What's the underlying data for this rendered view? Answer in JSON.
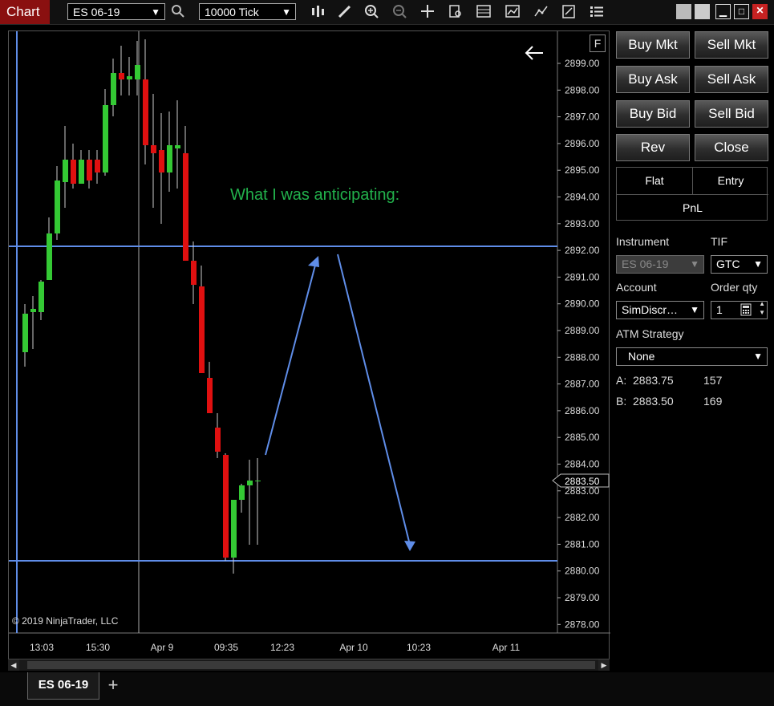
{
  "toolbar": {
    "app_title": "Chart",
    "instrument": "ES 06-19",
    "interval": "10000 Tick"
  },
  "chart": {
    "float_button": "F",
    "annotation": "What I was anticipating:",
    "copyright": "© 2019 NinjaTrader, LLC",
    "current_price": "2883.50",
    "price_axis": [
      "2899.00",
      "2898.00",
      "2897.00",
      "2896.00",
      "2895.00",
      "2894.00",
      "2893.00",
      "2892.00",
      "2891.00",
      "2890.00",
      "2889.00",
      "2888.00",
      "2887.00",
      "2886.00",
      "2885.00",
      "2884.00",
      "2883.00",
      "2882.00",
      "2881.00",
      "2880.00",
      "2879.00",
      "2878.00"
    ],
    "time_axis": [
      "13:03",
      "15:30",
      "Apr 9",
      "09:35",
      "12:23",
      "Apr 10",
      "10:23",
      "Apr 11"
    ],
    "colors": {
      "up": "#34c934",
      "down": "#e01010",
      "line": "#5f8de8",
      "text": "#22b14c"
    }
  },
  "tabs": {
    "active": "ES 06-19",
    "add": "+"
  },
  "order": {
    "buy_mkt": "Buy Mkt",
    "sell_mkt": "Sell Mkt",
    "buy_ask": "Buy Ask",
    "sell_ask": "Sell Ask",
    "buy_bid": "Buy Bid",
    "sell_bid": "Sell Bid",
    "rev": "Rev",
    "close": "Close",
    "flat": "Flat",
    "entry": "Entry",
    "pnl": "PnL",
    "instrument_label": "Instrument",
    "instrument_value": "ES 06-19",
    "tif_label": "TIF",
    "tif_value": "GTC",
    "account_label": "Account",
    "account_value": "SimDiscr…",
    "qty_label": "Order qty",
    "qty_value": "1",
    "atm_label": "ATM Strategy",
    "atm_value": "None",
    "ask_label": "A:",
    "ask_price": "2883.75",
    "ask_size": "157",
    "bid_label": "B:",
    "bid_price": "2883.50",
    "bid_size": "169"
  }
}
